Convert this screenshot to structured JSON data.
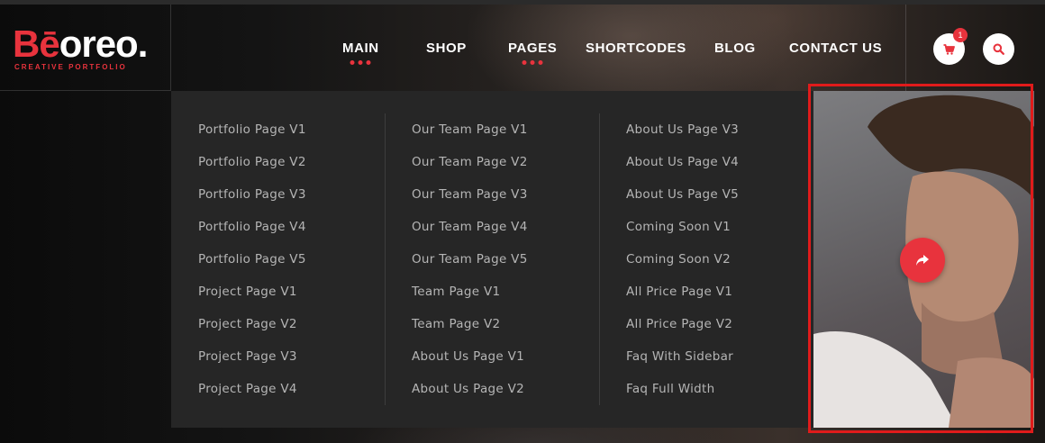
{
  "brand": {
    "logo_accent": "Bē",
    "logo_rest": "oreo.",
    "tagline": "CREATIVE PORTFOLIO",
    "accent_color": "#e8333d"
  },
  "nav": {
    "items": [
      {
        "label": "MAIN",
        "active": true
      },
      {
        "label": "SHOP",
        "active": false
      },
      {
        "label": "PAGES",
        "active": true
      },
      {
        "label": "SHORTCODES",
        "active": false
      },
      {
        "label": "BLOG",
        "active": false
      },
      {
        "label": "CONTACT US",
        "active": false
      }
    ],
    "cart_count": "1",
    "cart_icon": "shopping-cart-icon",
    "search_icon": "search-icon"
  },
  "mega_menu": {
    "columns": [
      [
        "Portfolio Page V1",
        "Portfolio Page V2",
        "Portfolio Page V3",
        "Portfolio Page V4",
        "Portfolio Page V5",
        "Project Page V1",
        "Project Page V2",
        "Project Page V3",
        "Project Page V4"
      ],
      [
        "Our Team Page V1",
        "Our Team Page V2",
        "Our Team Page V3",
        "Our Team Page V4",
        "Our Team Page V5",
        "Team Page V1",
        "Team Page V2",
        "About Us Page V1",
        "About Us Page V2"
      ],
      [
        "About Us Page V3",
        "About Us Page V4",
        "About Us Page V5",
        "Coming Soon V1",
        "Coming Soon V2",
        "All Price Page V1",
        "All Price Page V2",
        "Faq With Sidebar",
        "Faq Full Width"
      ]
    ],
    "promo_icon": "share-icon"
  }
}
